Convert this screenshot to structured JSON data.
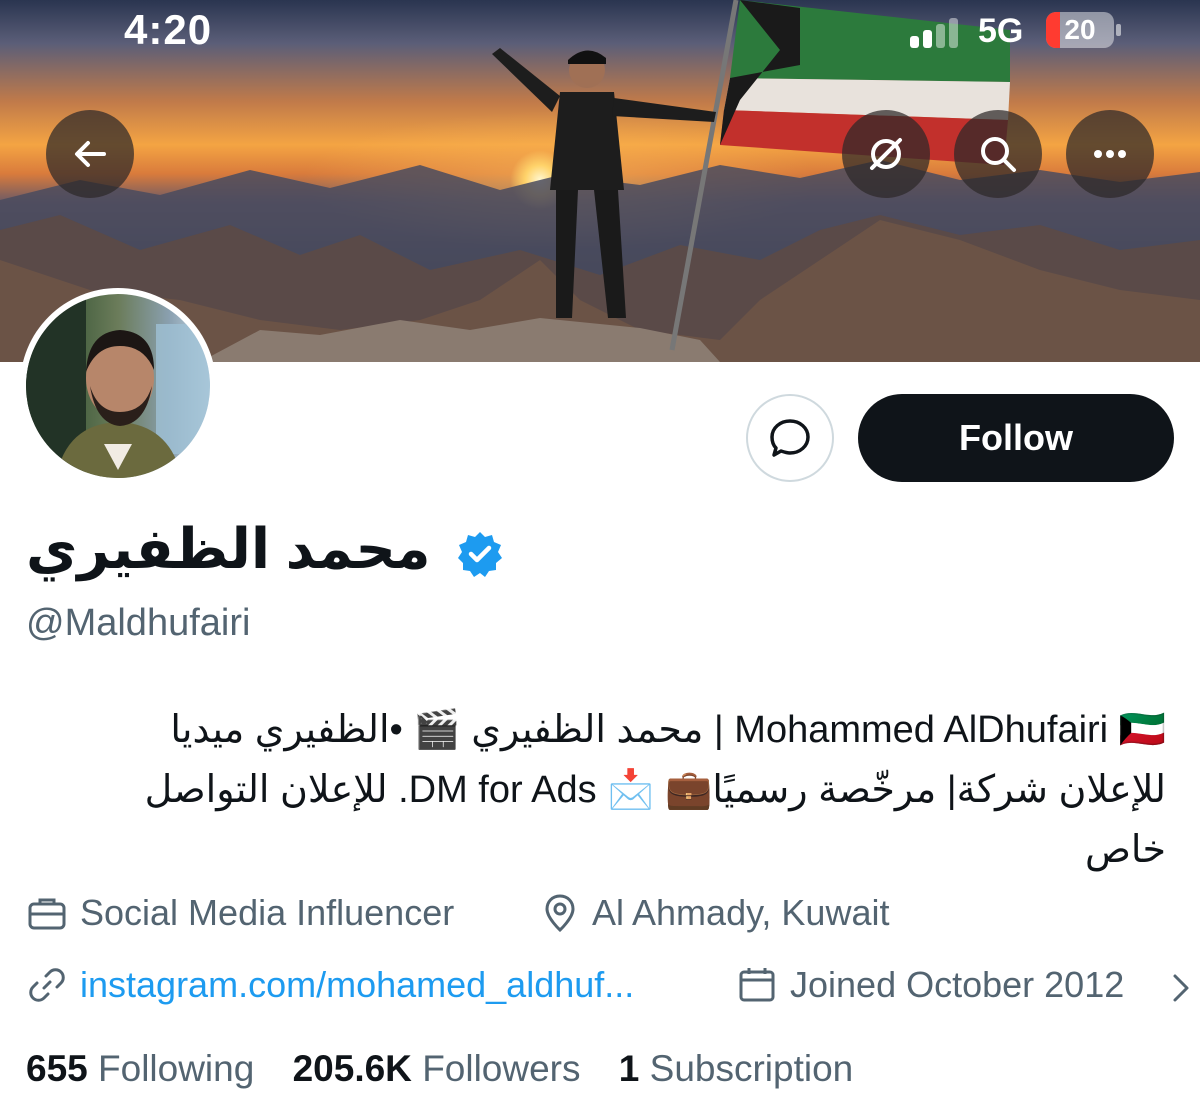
{
  "status_bar": {
    "time": "4:20",
    "network": "5G",
    "battery": "20",
    "battery_level": 0.2,
    "battery_color": "#ff3b30"
  },
  "header": {
    "back_icon": "arrow-left-icon",
    "translate_icon": "slashed-circle-icon",
    "search_icon": "search-icon",
    "more_icon": "more-horizontal-icon"
  },
  "profile": {
    "name": "محمد الظفيري",
    "handle": "@Maldhufairi",
    "verified_color": "#1d9bf0",
    "bio_lines": [
      "Mohammed AlDhufairi 🇰🇼 | محمد الظفيري 🎬 •الظفيري ميديا",
      "للإعلان شركة| مرخّصة رسميًا💼 📩 DM for Ads. للإعلان التواصل",
      "خاص"
    ],
    "category": "Social Media Influencer",
    "location": "Al Ahmady, Kuwait",
    "website": "instagram.com/mohamed_aldhuf...",
    "joined": "Joined October 2012"
  },
  "actions": {
    "message_icon": "message-bubble-icon",
    "follow_label": "Follow"
  },
  "stats": {
    "following_count": "655",
    "following_label": "Following",
    "followers_count": "205.6K",
    "followers_label": "Followers",
    "subscription_count": "1",
    "subscription_label": "Subscription"
  },
  "colors": {
    "text": "#0f1419",
    "muted": "#536471",
    "link": "#1d9bf0",
    "follow_bg": "#0f1419"
  }
}
